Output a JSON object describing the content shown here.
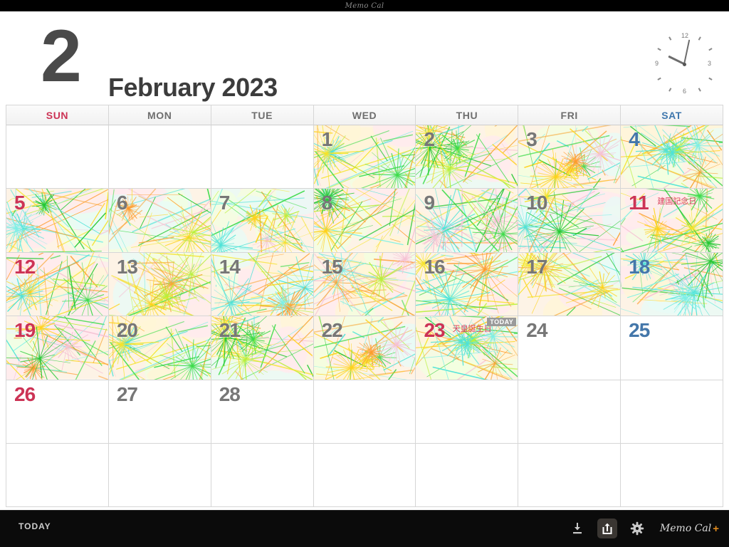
{
  "titlebar": {
    "brand": "Memo Cal"
  },
  "header": {
    "month_number": "2",
    "month_title": "February 2023",
    "clock": {
      "n12": "12",
      "n3": "3",
      "n6": "6",
      "n9": "9"
    }
  },
  "calendar": {
    "weekday_headers": [
      "SUN",
      "MON",
      "TUE",
      "WED",
      "THU",
      "FRI",
      "SAT"
    ],
    "weeks": [
      [
        {
          "day": "",
          "art": false,
          "kind": "sun"
        },
        {
          "day": "",
          "art": false,
          "kind": "day"
        },
        {
          "day": "",
          "art": false,
          "kind": "day"
        },
        {
          "day": "1",
          "art": true,
          "kind": "day"
        },
        {
          "day": "2",
          "art": true,
          "kind": "day"
        },
        {
          "day": "3",
          "art": true,
          "kind": "day"
        },
        {
          "day": "4",
          "art": true,
          "kind": "sat"
        }
      ],
      [
        {
          "day": "5",
          "art": true,
          "kind": "sun"
        },
        {
          "day": "6",
          "art": true,
          "kind": "day"
        },
        {
          "day": "7",
          "art": true,
          "kind": "day"
        },
        {
          "day": "8",
          "art": true,
          "kind": "day"
        },
        {
          "day": "9",
          "art": true,
          "kind": "day"
        },
        {
          "day": "10",
          "art": true,
          "kind": "day"
        },
        {
          "day": "11",
          "art": true,
          "kind": "holiday",
          "holiday": "建国記念日"
        }
      ],
      [
        {
          "day": "12",
          "art": true,
          "kind": "sun"
        },
        {
          "day": "13",
          "art": true,
          "kind": "day"
        },
        {
          "day": "14",
          "art": true,
          "kind": "day"
        },
        {
          "day": "15",
          "art": true,
          "kind": "day"
        },
        {
          "day": "16",
          "art": true,
          "kind": "day"
        },
        {
          "day": "17",
          "art": true,
          "kind": "day"
        },
        {
          "day": "18",
          "art": true,
          "kind": "sat"
        }
      ],
      [
        {
          "day": "19",
          "art": true,
          "kind": "sun"
        },
        {
          "day": "20",
          "art": true,
          "kind": "day"
        },
        {
          "day": "21",
          "art": true,
          "kind": "day"
        },
        {
          "day": "22",
          "art": true,
          "kind": "day"
        },
        {
          "day": "23",
          "art": true,
          "kind": "holiday",
          "holiday": "天皇誕生日",
          "today": "TODAY"
        },
        {
          "day": "24",
          "art": false,
          "kind": "day"
        },
        {
          "day": "25",
          "art": false,
          "kind": "sat"
        }
      ],
      [
        {
          "day": "26",
          "art": false,
          "kind": "sun"
        },
        {
          "day": "27",
          "art": false,
          "kind": "day"
        },
        {
          "day": "28",
          "art": false,
          "kind": "day"
        },
        {
          "day": "",
          "art": false,
          "kind": "day"
        },
        {
          "day": "",
          "art": false,
          "kind": "day"
        },
        {
          "day": "",
          "art": false,
          "kind": "day"
        },
        {
          "day": "",
          "art": false,
          "kind": "sat"
        }
      ],
      [
        {
          "day": "",
          "art": false,
          "kind": "sun"
        },
        {
          "day": "",
          "art": false,
          "kind": "day"
        },
        {
          "day": "",
          "art": false,
          "kind": "day"
        },
        {
          "day": "",
          "art": false,
          "kind": "day"
        },
        {
          "day": "",
          "art": false,
          "kind": "day"
        },
        {
          "day": "",
          "art": false,
          "kind": "day"
        },
        {
          "day": "",
          "art": false,
          "kind": "sat"
        }
      ]
    ]
  },
  "toolbar": {
    "today_label": "TODAY",
    "import_icon": "download-icon",
    "share_icon": "share-icon",
    "settings_icon": "gear-icon",
    "brand": "Memo Cal",
    "brand_plus": "+"
  },
  "colors": {
    "sunday": "#cc3355",
    "saturday": "#4477aa",
    "weekday": "#777777",
    "holiday_label": "#d8405c",
    "toolbar_bg": "#0b0b0b",
    "accent_orange": "#e08a1e"
  }
}
